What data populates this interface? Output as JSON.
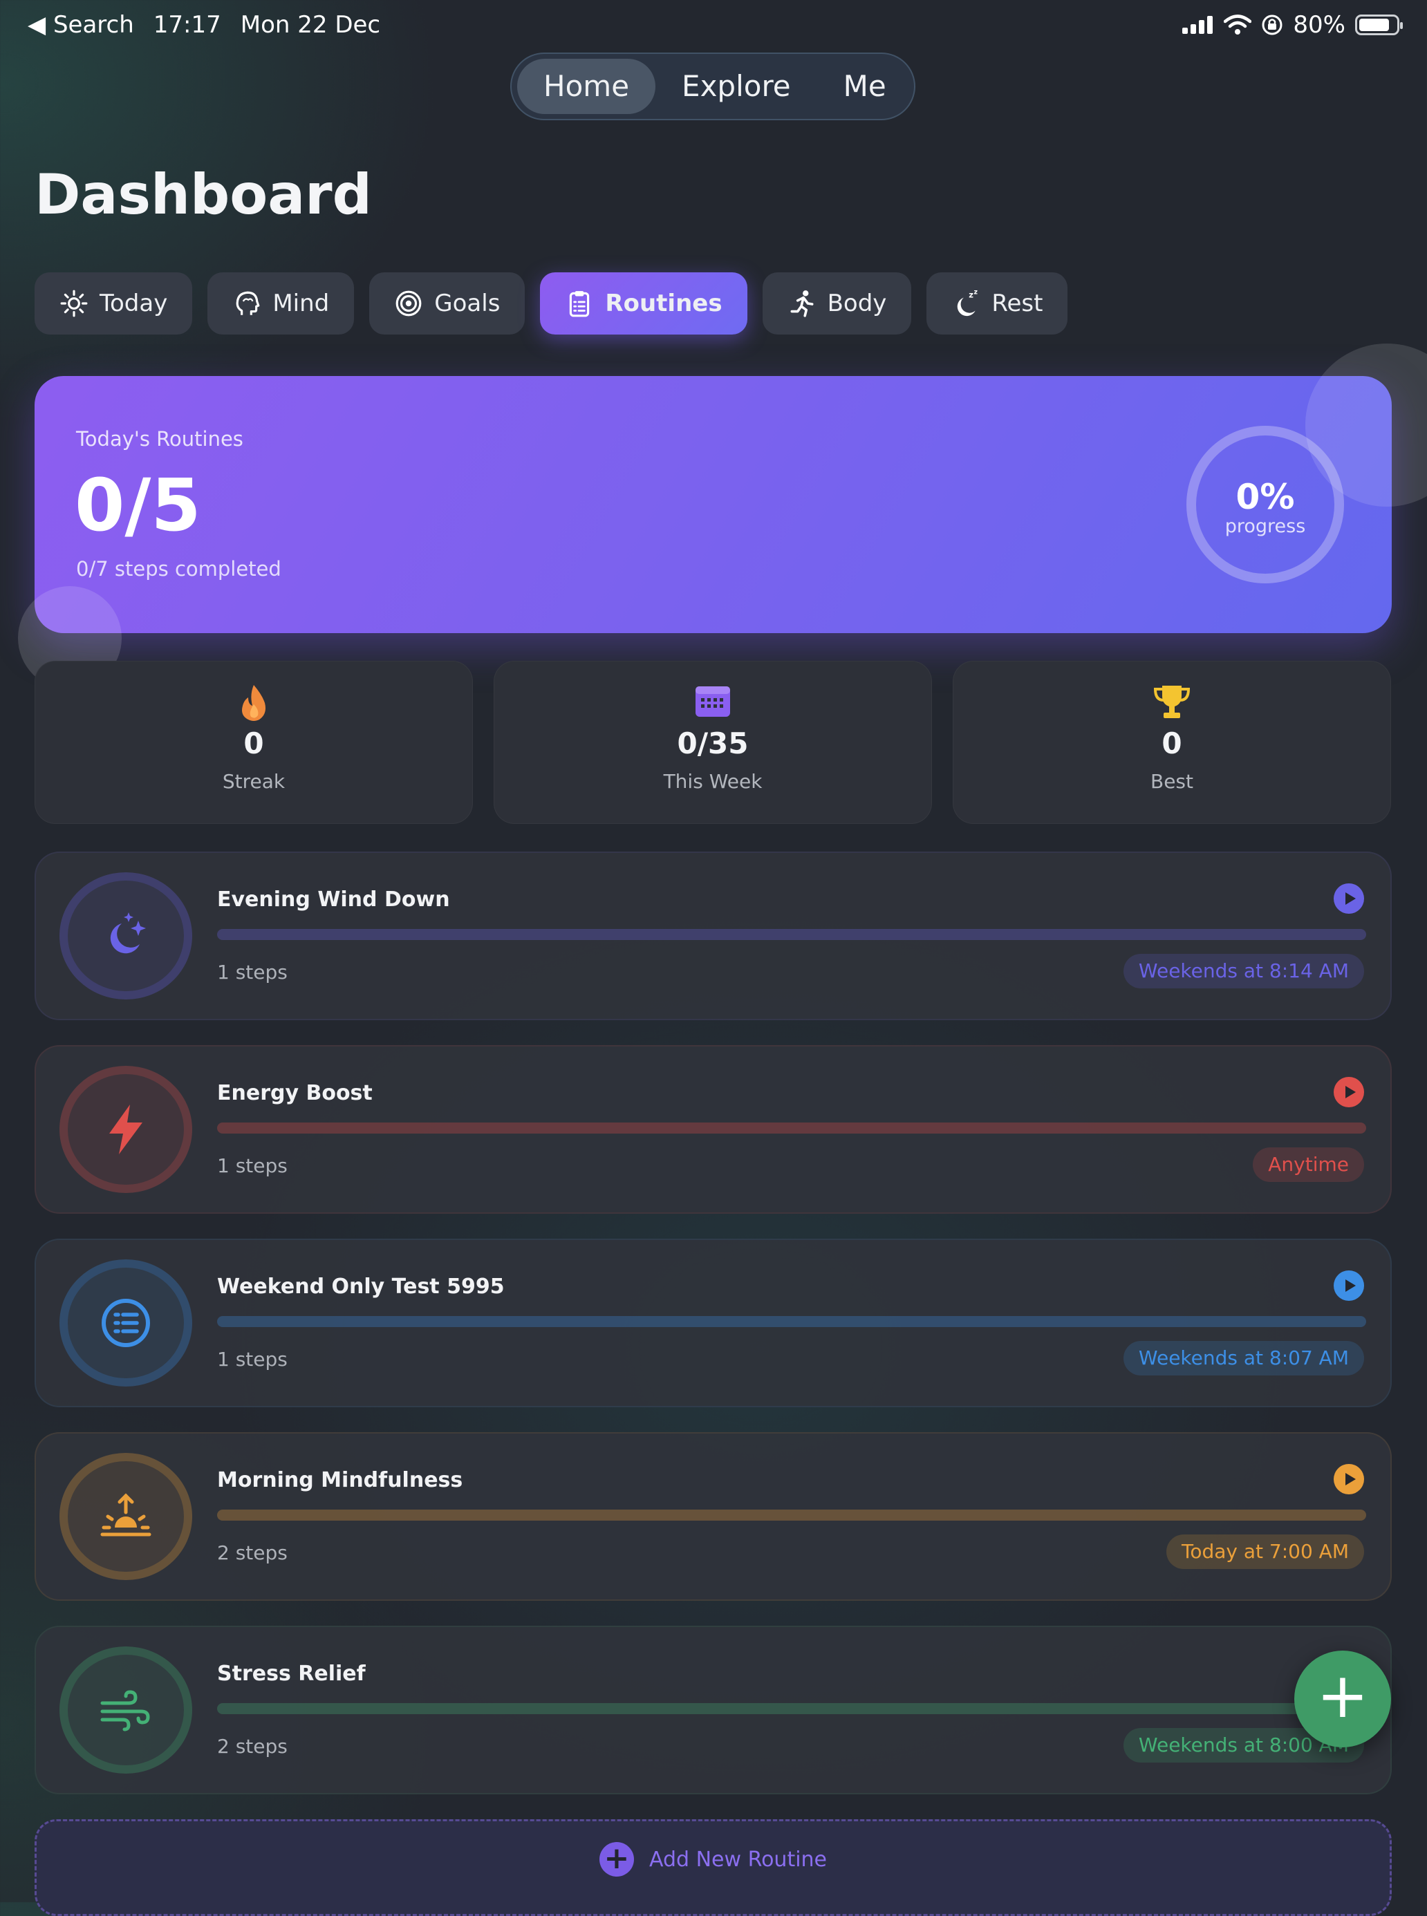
{
  "status_bar": {
    "back_label": "◀ Search",
    "time": "17:17",
    "date": "Mon 22 Dec",
    "battery": "80%",
    "battery_level": 0.8
  },
  "top_nav": {
    "items": [
      "Home",
      "Explore",
      "Me"
    ],
    "active": "Home"
  },
  "page_title": "Dashboard",
  "category_tabs": [
    {
      "label": "Today",
      "icon": "sun-icon"
    },
    {
      "label": "Mind",
      "icon": "brain-icon"
    },
    {
      "label": "Goals",
      "icon": "target-icon"
    },
    {
      "label": "Routines",
      "icon": "clipboard-icon",
      "active": true
    },
    {
      "label": "Body",
      "icon": "running-icon"
    },
    {
      "label": "Rest",
      "icon": "moon-zzz-icon"
    }
  ],
  "summary": {
    "label": "Today's Routines",
    "count": "0/5",
    "steps_text": "0/7 steps completed",
    "progress_value": "0%",
    "progress_label": "progress"
  },
  "stats": [
    {
      "value": "0",
      "label": "Streak",
      "icon": "flame-icon"
    },
    {
      "value": "0/35",
      "label": "This Week",
      "icon": "calendar-icon"
    },
    {
      "value": "0",
      "label": "Best",
      "icon": "trophy-icon"
    }
  ],
  "routines": [
    {
      "name": "Evening Wind Down",
      "steps": "1 steps",
      "schedule": "Weekends at 8:14 AM",
      "icon": "moon-stars-icon",
      "color": "#6a63e6"
    },
    {
      "name": "Energy Boost",
      "steps": "1 steps",
      "schedule": "Anytime",
      "icon": "lightning-icon",
      "color": "#e0504c"
    },
    {
      "name": "Weekend Only Test 5995",
      "steps": "1 steps",
      "schedule": "Weekends at 8:07 AM",
      "icon": "list-icon",
      "color": "#3d8fe6"
    },
    {
      "name": "Morning Mindfulness",
      "steps": "2 steps",
      "schedule": "Today at 7:00 AM",
      "icon": "sunrise-icon",
      "color": "#eba03a"
    },
    {
      "name": "Stress Relief",
      "steps": "2 steps",
      "schedule": "Weekends at 8:00 AM",
      "icon": "wind-icon",
      "color": "#44b176"
    }
  ],
  "add_routine_label": "Add New Routine",
  "fab_label": "+",
  "colors": {
    "accent_purple": "#7b5ce6",
    "fab_green": "#3f9b66"
  }
}
